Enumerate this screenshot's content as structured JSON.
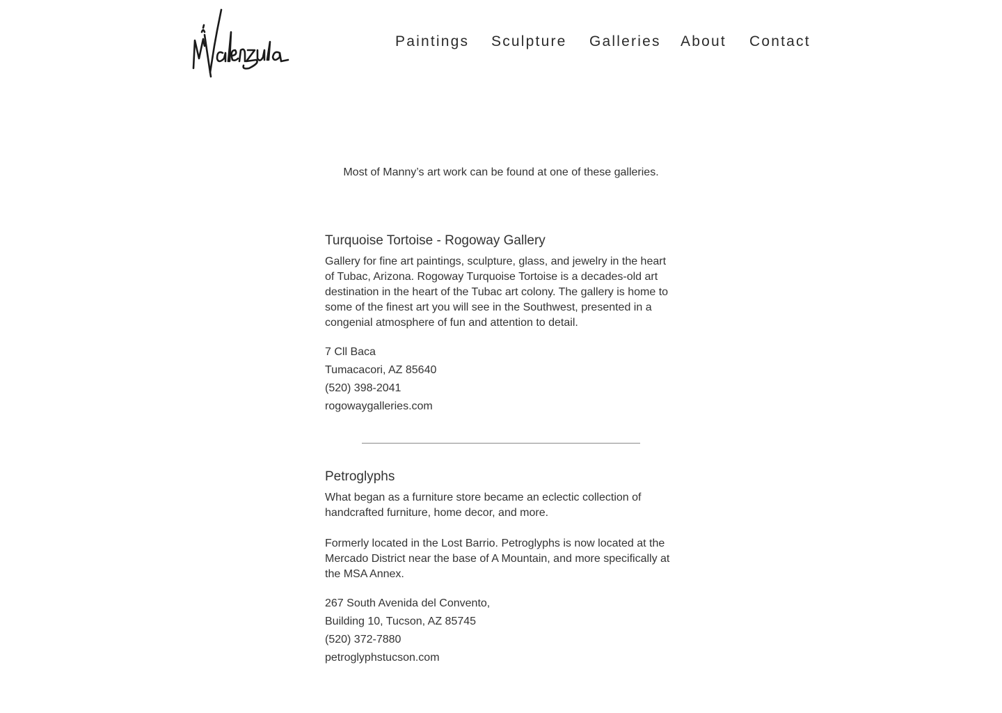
{
  "logo": {
    "text": "MValenzuela",
    "icon": "signature-logo"
  },
  "nav": {
    "items": [
      {
        "label": "Paintings"
      },
      {
        "label": "Sculpture"
      },
      {
        "label": "Galleries"
      },
      {
        "label": "About"
      },
      {
        "label": "Contact"
      }
    ]
  },
  "intro": "Most of Manny’s art work can be found at one of these galleries.",
  "galleries": [
    {
      "name": "Turquoise Tortoise - Rogoway Gallery",
      "description": [
        "Gallery for fine art paintings, sculpture, glass, and jewelry in the heart of Tubac, Arizona. Rogoway Turquoise Tortoise is a decades-old art destination in the heart of the Tubac art colony. The gallery is home to some of the finest art you will see in the Southwest, presented in a congenial atmosphere of fun and attention to detail."
      ],
      "address_line1": "7 Cll Baca",
      "address_line2": "Tumacacori, AZ 85640",
      "phone": "(520) 398-2041",
      "website": "rogowaygalleries.com"
    },
    {
      "name": "Petroglyphs",
      "description": [
        "What began as a furniture store became an eclectic collection of handcrafted furniture, home decor, and more.",
        "Formerly located in the Lost Barrio. Petroglyphs is now located at the Mercado District near the base of A Mountain, and more specifically at the MSA Annex."
      ],
      "address_line1": "267 South Avenida del Convento,",
      "address_line2": "Building 10, Tucson, AZ 85745",
      "phone": "(520) 372-7880",
      "website": "petroglyphstucson.com"
    }
  ],
  "colors": {
    "text": "#2b2b2b",
    "background": "#ffffff",
    "divider": "#8a8a8a"
  }
}
